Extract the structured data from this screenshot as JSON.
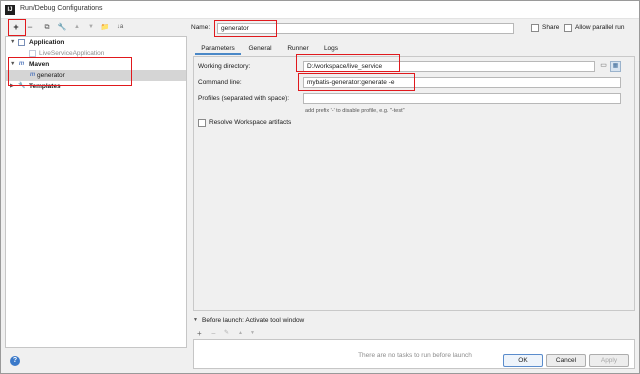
{
  "window": {
    "title": "Run/Debug Configurations",
    "app_icon_text": "IJ"
  },
  "toolbar": {
    "add": "+",
    "remove": "−",
    "copy": "⧉",
    "edit": "🔧",
    "up": "▲",
    "down": "▼",
    "folder": "📁",
    "sort": "↓a"
  },
  "tree": {
    "application_label": "Application",
    "application_child": "LiveServiceApplication",
    "maven_label": "Maven",
    "maven_child": "generator",
    "templates_label": "Templates"
  },
  "config": {
    "name_label": "Name:",
    "name_value": "generator",
    "share_label": "Share",
    "parallel_label": "Allow parallel run",
    "tabs": [
      "Parameters",
      "General",
      "Runner",
      "Logs"
    ],
    "working_dir_label": "Working directory:",
    "working_dir_value": "D:/workspace/live_service",
    "command_line_label": "Command line:",
    "command_line_value": "mybatis-generator:generate -e",
    "profiles_label": "Profiles (separated with space):",
    "profiles_value": "",
    "profiles_hint": "add prefix '-' to disable profile, e.g. \"-test\"",
    "resolve_label": "Resolve Workspace artifacts"
  },
  "before_launch": {
    "title": "Before launch: Activate tool window",
    "empty_text": "There are no tasks to run before launch"
  },
  "buttons": {
    "help": "?",
    "ok": "OK",
    "cancel": "Cancel",
    "apply": "Apply"
  }
}
